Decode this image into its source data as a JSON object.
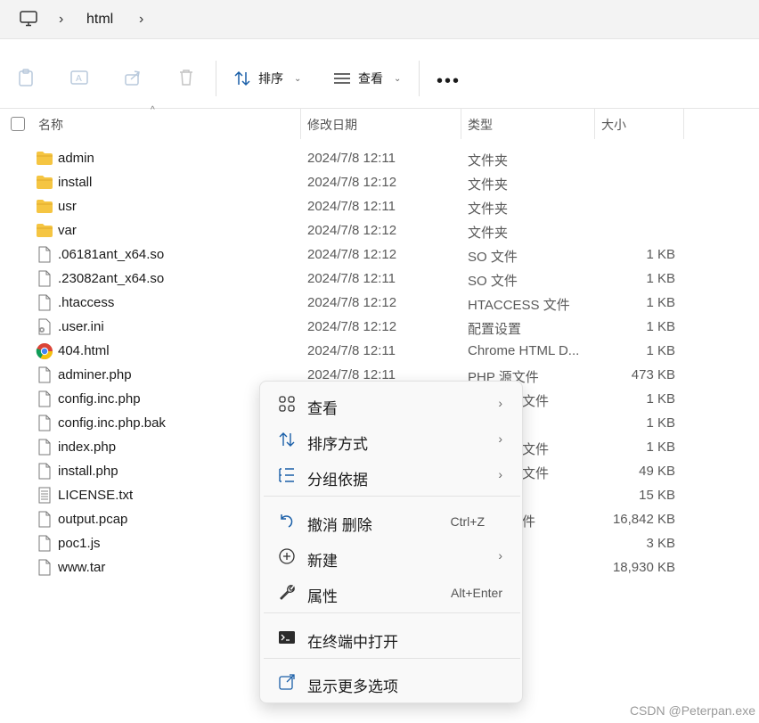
{
  "address": {
    "crumb": "html"
  },
  "toolbar": {
    "sort_label": "排序",
    "view_label": "查看",
    "more_label": "•••"
  },
  "columns": {
    "name": "名称",
    "modified": "修改日期",
    "type": "类型",
    "size": "大小"
  },
  "files": [
    {
      "name": "admin",
      "date": "2024/7/8 12:11",
      "type": "文件夹",
      "size": "",
      "icon": "folder-icon"
    },
    {
      "name": "install",
      "date": "2024/7/8 12:12",
      "type": "文件夹",
      "size": "",
      "icon": "folder-icon"
    },
    {
      "name": "usr",
      "date": "2024/7/8 12:11",
      "type": "文件夹",
      "size": "",
      "icon": "folder-icon"
    },
    {
      "name": "var",
      "date": "2024/7/8 12:12",
      "type": "文件夹",
      "size": "",
      "icon": "folder-icon"
    },
    {
      "name": ".06181ant_x64.so",
      "date": "2024/7/8 12:12",
      "type": "SO 文件",
      "size": "1 KB",
      "icon": "file-icon"
    },
    {
      "name": ".23082ant_x64.so",
      "date": "2024/7/8 12:11",
      "type": "SO 文件",
      "size": "1 KB",
      "icon": "file-icon"
    },
    {
      "name": ".htaccess",
      "date": "2024/7/8 12:12",
      "type": "HTACCESS 文件",
      "size": "1 KB",
      "icon": "file-icon"
    },
    {
      "name": ".user.ini",
      "date": "2024/7/8 12:12",
      "type": "配置设置",
      "size": "1 KB",
      "icon": "settings-file-icon"
    },
    {
      "name": "404.html",
      "date": "2024/7/8 12:11",
      "type": "Chrome HTML D...",
      "size": "1 KB",
      "icon": "chrome-icon"
    },
    {
      "name": "adminer.php",
      "date": "2024/7/8 12:11",
      "type": "PHP 源文件",
      "size": "473 KB",
      "icon": "file-icon"
    },
    {
      "name": "config.inc.php",
      "date": "",
      "type": "文件",
      "size": "1 KB",
      "icon": "file-icon"
    },
    {
      "name": "config.inc.php.bak",
      "date": "",
      "type": "",
      "size": "1 KB",
      "icon": "file-icon"
    },
    {
      "name": "index.php",
      "date": "",
      "type": "文件",
      "size": "1 KB",
      "icon": "file-icon"
    },
    {
      "name": "install.php",
      "date": "",
      "type": "文件",
      "size": "49 KB",
      "icon": "file-icon"
    },
    {
      "name": "LICENSE.txt",
      "date": "",
      "type": "",
      "size": "15 KB",
      "icon": "text-file-icon"
    },
    {
      "name": "output.pcap",
      "date": "",
      "type": "件",
      "size": "16,842 KB",
      "icon": "file-icon"
    },
    {
      "name": "poc1.js",
      "date": "",
      "type": "",
      "size": "3 KB",
      "icon": "file-icon"
    },
    {
      "name": "www.tar",
      "date": "",
      "type": "",
      "size": "18,930 KB",
      "icon": "file-icon"
    }
  ],
  "context_menu": {
    "view": "查看",
    "sort": "排序方式",
    "group": "分组依据",
    "undo": "撤消 删除",
    "undo_key": "Ctrl+Z",
    "new": "新建",
    "properties": "属性",
    "properties_key": "Alt+Enter",
    "terminal": "在终端中打开",
    "more_options": "显示更多选项"
  },
  "watermark": "CSDN @Peterpan.exe",
  "colors": {
    "folder": "#f5c542",
    "accent": "#0067c0"
  }
}
